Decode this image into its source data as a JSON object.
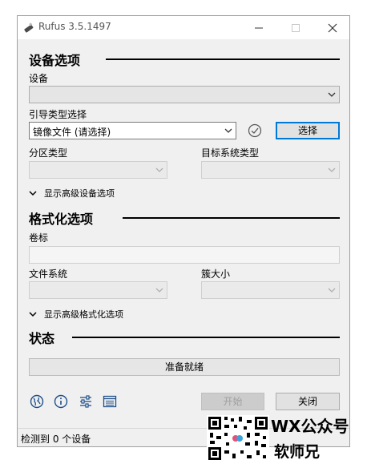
{
  "window": {
    "title": "Rufus 3.5.1497"
  },
  "drive_section": {
    "heading": "设备选项",
    "device_label": "设备",
    "device_value": "",
    "boot_label": "引导类型选择",
    "boot_value": "镜像文件 (请选择)",
    "select_button": "选择",
    "partition_label": "分区类型",
    "partition_value": "",
    "target_label": "目标系统类型",
    "target_value": "",
    "advanced_toggle": "显示高级设备选项"
  },
  "format_section": {
    "heading": "格式化选项",
    "volume_label": "卷标",
    "volume_value": "",
    "filesystem_label": "文件系统",
    "filesystem_value": "",
    "cluster_label": "簇大小",
    "cluster_value": "",
    "advanced_toggle": "显示高级格式化选项"
  },
  "status_section": {
    "heading": "状态",
    "status_text": "准备就绪"
  },
  "actions": {
    "start": "开始",
    "close": "关闭"
  },
  "icons": [
    "globe-icon",
    "info-icon",
    "settings-sliders-icon",
    "log-icon"
  ],
  "footer": {
    "status": "检测到 0 个设备"
  },
  "watermark": {
    "line1": "WX公众号",
    "line2": "软师兄"
  },
  "colors": {
    "accent": "#0078d7",
    "window_bg": "#f0f0f0"
  }
}
